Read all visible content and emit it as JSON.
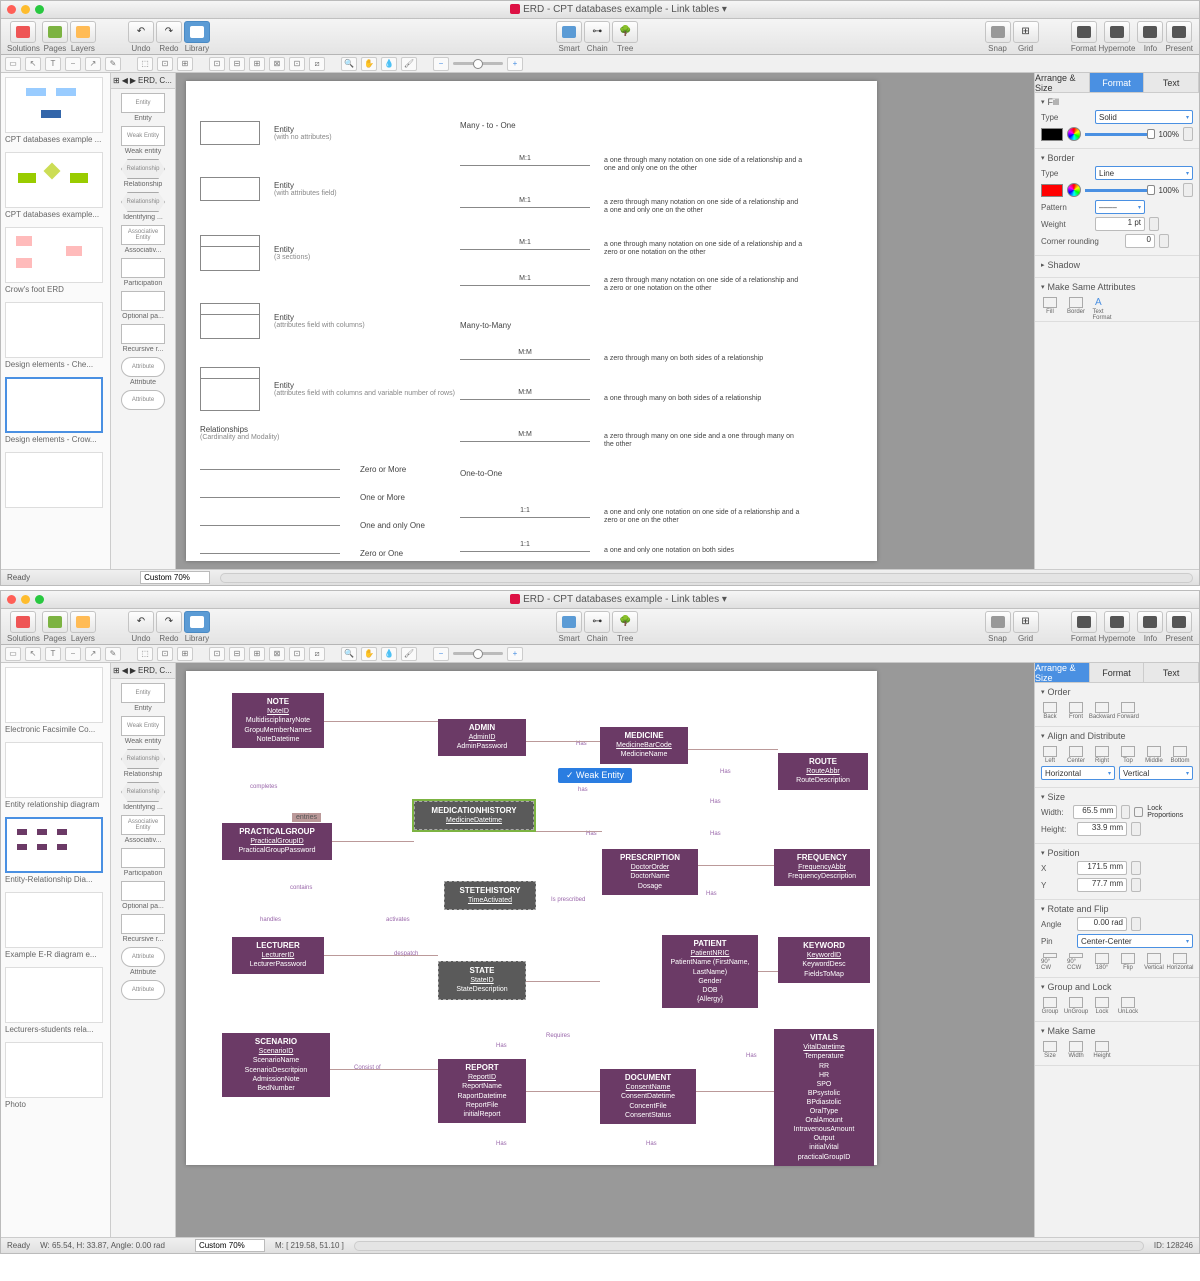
{
  "window_title": "ERD - CPT databases example - Link tables",
  "main_toolbar": {
    "left": [
      {
        "icon": "solutions",
        "label": "Solutions"
      },
      {
        "icon": "pages",
        "label": "Pages"
      },
      {
        "icon": "layers",
        "label": "Layers"
      }
    ],
    "left2": [
      {
        "icon": "undo",
        "label": "Undo"
      },
      {
        "icon": "redo",
        "label": "Redo"
      },
      {
        "icon": "library",
        "label": "Library",
        "active": true
      }
    ],
    "center": [
      {
        "icon": "smart",
        "label": "Smart"
      },
      {
        "icon": "chain",
        "label": "Chain"
      },
      {
        "icon": "tree",
        "label": "Tree"
      }
    ],
    "right1": [
      {
        "icon": "snap",
        "label": "Snap"
      },
      {
        "icon": "grid",
        "label": "Grid"
      }
    ],
    "right2": [
      {
        "icon": "format",
        "label": "Format"
      },
      {
        "icon": "hypernote",
        "label": "Hypernote"
      },
      {
        "icon": "info",
        "label": "Info"
      },
      {
        "icon": "present",
        "label": "Present"
      }
    ]
  },
  "shape_nav": "ERD, C...",
  "shapes": [
    {
      "label": "Entity",
      "thumb": "Entity"
    },
    {
      "label": "Weak entity",
      "thumb": "Weak Entity"
    },
    {
      "label": "Relationship",
      "thumb": "Relationship"
    },
    {
      "label": "Identifying ...",
      "thumb": "Relationship"
    },
    {
      "label": "Associativ...",
      "thumb": "Associative Entity"
    },
    {
      "label": "Participation",
      "thumb": ""
    },
    {
      "label": "Optional pa...",
      "thumb": ""
    },
    {
      "label": "Recursive r...",
      "thumb": ""
    },
    {
      "label": "Attribute",
      "thumb": "Attribute"
    },
    {
      "label": "",
      "thumb": "Attribute"
    }
  ],
  "gallery_top": [
    "CPT databases example ...",
    "CPT databases example...",
    "Crow's foot ERD",
    "Design elements - Che...",
    "Design elements - Crow..."
  ],
  "gallery_bottom": [
    "Electronic Facsimile Co...",
    "Entity relationship diagram",
    "Entity-Relationship Dia...",
    "Example E-R diagram e...",
    "Lecturers-students rela...",
    "Photo"
  ],
  "erd_legend": {
    "entities": [
      {
        "title": "Entity",
        "sub": "(with no attributes)"
      },
      {
        "title": "Entity",
        "sub": "(with attributes field)"
      },
      {
        "title": "Entity",
        "sub": "(3 sections)"
      },
      {
        "title": "Entity",
        "sub": "(attributes field with columns)"
      },
      {
        "title": "Entity",
        "sub": "(attributes field with columns and variable number of rows)"
      }
    ],
    "rel_header": {
      "title": "Relationships",
      "sub": "(Cardinality and Modality)"
    },
    "cardinalities": [
      "Zero or More",
      "One or More",
      "One and only One",
      "Zero or One"
    ],
    "col2_headers": [
      "Many - to - One",
      "Many-to-Many",
      "One-to-One"
    ],
    "relations": [
      {
        "label": "M:1",
        "desc": "a one through many notation on one side of a relationship and a one and only one on the other"
      },
      {
        "label": "M:1",
        "desc": "a zero through many notation on one side of a relationship and a one and only one on the other"
      },
      {
        "label": "M:1",
        "desc": "a one through many notation on one side of a relationship and a zero or one notation on the other"
      },
      {
        "label": "M:1",
        "desc": "a zero through many notation on one side of a relationship and a zero or one notation on the other"
      },
      {
        "label": "M:M",
        "desc": "a zero through many on both sides of a relationship"
      },
      {
        "label": "M:M",
        "desc": "a one through many on both sides of a relationship"
      },
      {
        "label": "M:M",
        "desc": "a zero through many on one side and a one through many on the other"
      },
      {
        "label": "1:1",
        "desc": "a one and only one notation on one side of a relationship and a zero or one on the other"
      },
      {
        "label": "1:1",
        "desc": "a one and only one notation on both sides"
      }
    ]
  },
  "panel_top": {
    "tabs": [
      "Arrange & Size",
      "Format",
      "Text"
    ],
    "active": "Format",
    "fill": {
      "header": "Fill",
      "type_label": "Type",
      "type_value": "Solid",
      "pct": "100%"
    },
    "border": {
      "header": "Border",
      "type_label": "Type",
      "type_value": "Line",
      "pct": "100%",
      "pattern_label": "Pattern",
      "weight_label": "Weight",
      "weight_value": "1 pt",
      "corner_label": "Corner rounding",
      "corner_value": "0"
    },
    "shadow": "Shadow",
    "make_same": {
      "header": "Make Same Attributes",
      "items": [
        "Fill",
        "Border",
        "Text Format"
      ]
    }
  },
  "panel_bottom": {
    "tabs": [
      "Arrange & Size",
      "Format",
      "Text"
    ],
    "active": "Arrange & Size",
    "order": {
      "header": "Order",
      "items": [
        "Back",
        "Front",
        "Backward",
        "Forward"
      ]
    },
    "align": {
      "header": "Align and Distribute",
      "items": [
        "Left",
        "Center",
        "Right",
        "Top",
        "Middle",
        "Bottom"
      ],
      "h": "Horizontal",
      "v": "Vertical"
    },
    "size": {
      "header": "Size",
      "width_label": "Width:",
      "width": "65.5 mm",
      "height_label": "Height:",
      "height": "33.9 mm",
      "lock": "Lock Proportions"
    },
    "position": {
      "header": "Position",
      "x_label": "X",
      "x": "171.5 mm",
      "y_label": "Y",
      "y": "77.7 mm"
    },
    "rotate": {
      "header": "Rotate and Flip",
      "angle_label": "Angle",
      "angle": "0.00 rad",
      "pin_label": "Pin",
      "pin": "Center-Center",
      "items": [
        "90° CW",
        "90° CCW",
        "180°",
        "Flip",
        "Vertical",
        "Horizontal"
      ]
    },
    "group": {
      "header": "Group and Lock",
      "items": [
        "Group",
        "UnGroup",
        "Lock",
        "UnLock"
      ]
    },
    "make_same": {
      "header": "Make Same",
      "items": [
        "Size",
        "Width",
        "Height"
      ]
    }
  },
  "diagram": {
    "tag": "Weak Entity",
    "entry_tag": "entries",
    "entities": {
      "note": {
        "title": "NOTE",
        "key": "NoteID",
        "attrs": [
          "MultidisciplinaryNote",
          "GropuMemberNames",
          "NoteDatetime"
        ]
      },
      "admin": {
        "title": "ADMIN",
        "key": "AdminID",
        "attrs": [
          "AdminPassword"
        ]
      },
      "medicine": {
        "title": "MEDICINE",
        "key": "MedicineBarCode",
        "attrs": [
          "MedicineName"
        ]
      },
      "route": {
        "title": "ROUTE",
        "key": "RouteAbbr",
        "attrs": [
          "RouteDescription"
        ]
      },
      "medhistory": {
        "title": "MEDICATIONHISTORY",
        "key": "MedicineDatetime",
        "attrs": []
      },
      "practical": {
        "title": "PRACTICALGROUP",
        "key": "PracticalGroupID",
        "attrs": [
          "PracticalGroupPassword"
        ]
      },
      "prescription": {
        "title": "PRESCRIPTION",
        "key": "DoctorOrder",
        "attrs": [
          "DoctorName",
          "Dosage"
        ]
      },
      "frequency": {
        "title": "FREQUENCY",
        "key": "FrequencyAbbr",
        "attrs": [
          "FrequencyDescription"
        ]
      },
      "statehistory": {
        "title": "STETEHISTORY",
        "key": "TimeActivated",
        "attrs": []
      },
      "lecturer": {
        "title": "LECTURER",
        "key": "LecturerID",
        "attrs": [
          "LecturerPassword"
        ]
      },
      "state": {
        "title": "STATE",
        "key": "StateID",
        "attrs": [
          "StateDescription"
        ]
      },
      "patient": {
        "title": "PATIENT",
        "key": "PatientNRIC",
        "attrs": [
          "PatientName (FirstName, LastName)",
          "Gender",
          "DOB",
          "{Allergy}"
        ]
      },
      "keyword": {
        "title": "KEYWORD",
        "key": "KeywordID",
        "attrs": [
          "KeywordDesc",
          "FieldsToMap"
        ]
      },
      "scenario": {
        "title": "SCENARIO",
        "key": "ScenarioID",
        "attrs": [
          "ScenarioName",
          "ScenarioDescritpion",
          "AdmissionNote",
          "BedNumber"
        ]
      },
      "report": {
        "title": "REPORT",
        "key": "ReportID",
        "attrs": [
          "ReportName",
          "RaportDatetime",
          "ReportFile",
          "initialReport"
        ]
      },
      "document": {
        "title": "DOCUMENT",
        "key": "ConsentName",
        "attrs": [
          "ConsentDatetime",
          "ConcentFile",
          "ConsentStatus"
        ]
      },
      "vitals": {
        "title": "VITALS",
        "key": "VitalDatetime",
        "attrs": [
          "Temperature",
          "RR",
          "HR",
          "SPO",
          "BPsystolic",
          "BPdiastolic",
          "OralType",
          "OralAmount",
          "IntravenousAmount",
          "Output",
          "initialVital",
          "practicalGroupID"
        ]
      }
    },
    "rel_labels": [
      "completes",
      "has",
      "Has",
      "contains",
      "handles",
      "activates",
      "despatch",
      "Is prescribed",
      "Consist of",
      "Requires"
    ]
  },
  "status1": {
    "ready": "Ready",
    "zoom": "Custom 70%"
  },
  "status2": {
    "ready": "Ready",
    "zoom": "Custom 70%",
    "whangle": "W: 65.54,  H: 33.87,  Angle: 0.00 rad",
    "mouse": "M: [ 219.58, 51.10 ]",
    "id": "ID: 128246"
  }
}
